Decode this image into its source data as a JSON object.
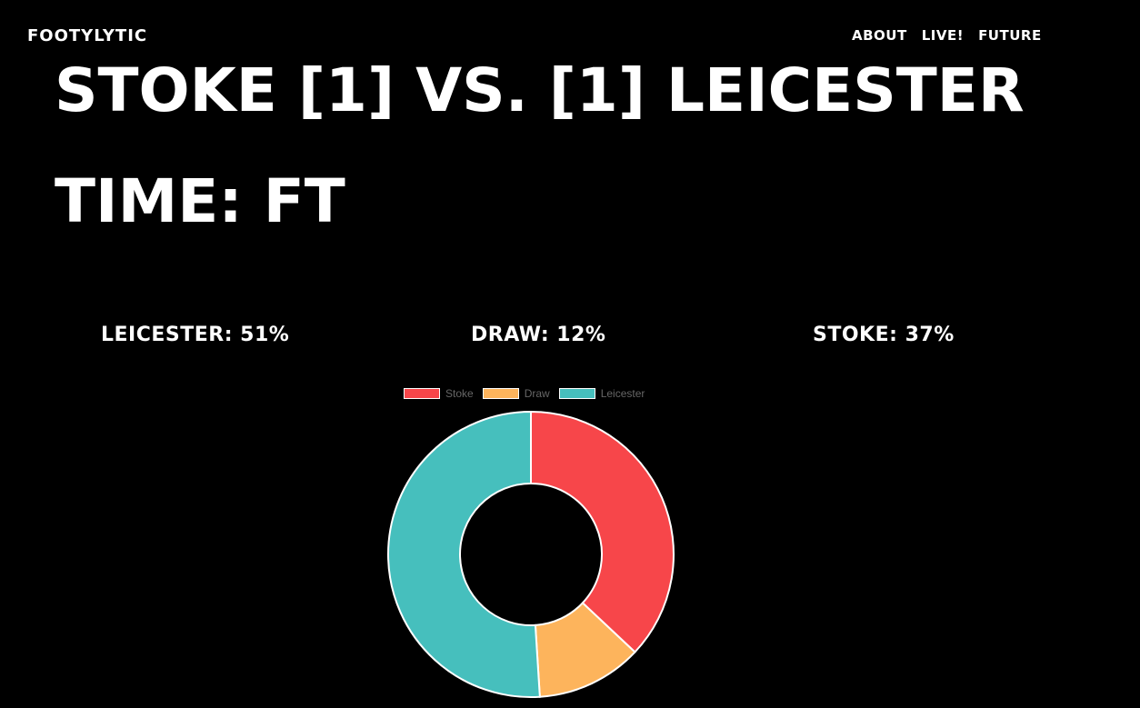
{
  "header": {
    "brand": "FOOTYLYTIC",
    "nav": [
      {
        "label": "ABOUT"
      },
      {
        "label": "LIVE!"
      },
      {
        "label": "FUTURE"
      }
    ]
  },
  "match": {
    "title": "STOKE [1] VS. [1] LEICESTER",
    "time": "TIME: FT"
  },
  "probabilities": {
    "leicester": "LEICESTER: 51%",
    "draw": "DRAW: 12%",
    "stoke": "STOKE: 37%"
  },
  "chart_data": {
    "type": "pie",
    "variant": "doughnut",
    "categories": [
      "Stoke",
      "Draw",
      "Leicester"
    ],
    "values": [
      37,
      12,
      51
    ],
    "colors": [
      "#F7464A",
      "#FDB45C",
      "#46BFBD"
    ],
    "legend": "top"
  }
}
